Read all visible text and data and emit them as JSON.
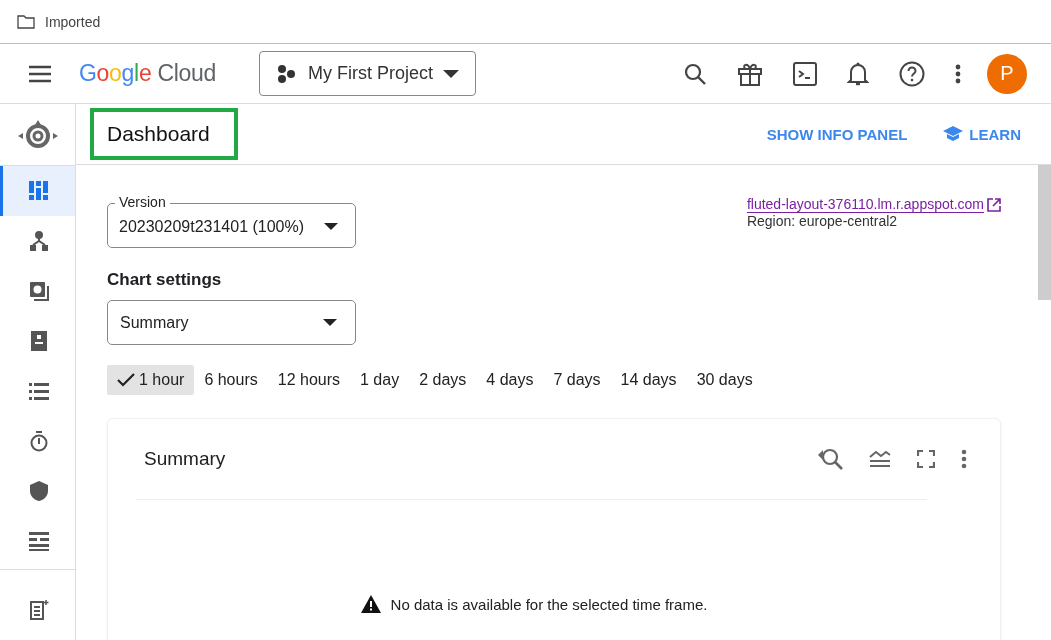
{
  "breadcrumb": {
    "label": "Imported"
  },
  "header": {
    "logo": {
      "brand": "Google",
      "product": "Cloud"
    },
    "project": "My First Project",
    "avatar": "P"
  },
  "sidebar": {
    "items": [
      {
        "selected": true
      },
      {
        "selected": false
      },
      {
        "selected": false
      },
      {
        "selected": false
      },
      {
        "selected": false
      },
      {
        "selected": false
      },
      {
        "selected": false
      },
      {
        "selected": false
      }
    ],
    "footer_items": [
      {
        "selected": false
      }
    ]
  },
  "page": {
    "title": "Dashboard",
    "actions": [
      "SHOW INFO PANEL",
      "LEARN"
    ]
  },
  "version": {
    "label": "Version",
    "value": "20230209t231401 (100%)"
  },
  "link": {
    "url": "fluted-layout-376110.lm.r.appspot.com",
    "region": "Region: europe-central2"
  },
  "chart_settings": {
    "label": "Chart settings",
    "value": "Summary"
  },
  "time_ranges": [
    {
      "label": "1 hour",
      "selected": true
    },
    {
      "label": "6 hours",
      "selected": false
    },
    {
      "label": "12 hours",
      "selected": false
    },
    {
      "label": "1 day",
      "selected": false
    },
    {
      "label": "2 days",
      "selected": false
    },
    {
      "label": "4 days",
      "selected": false
    },
    {
      "label": "7 days",
      "selected": false
    },
    {
      "label": "14 days",
      "selected": false
    },
    {
      "label": "30 days",
      "selected": false
    }
  ],
  "card": {
    "title": "Summary",
    "message": "No data is available for the selected time frame."
  }
}
